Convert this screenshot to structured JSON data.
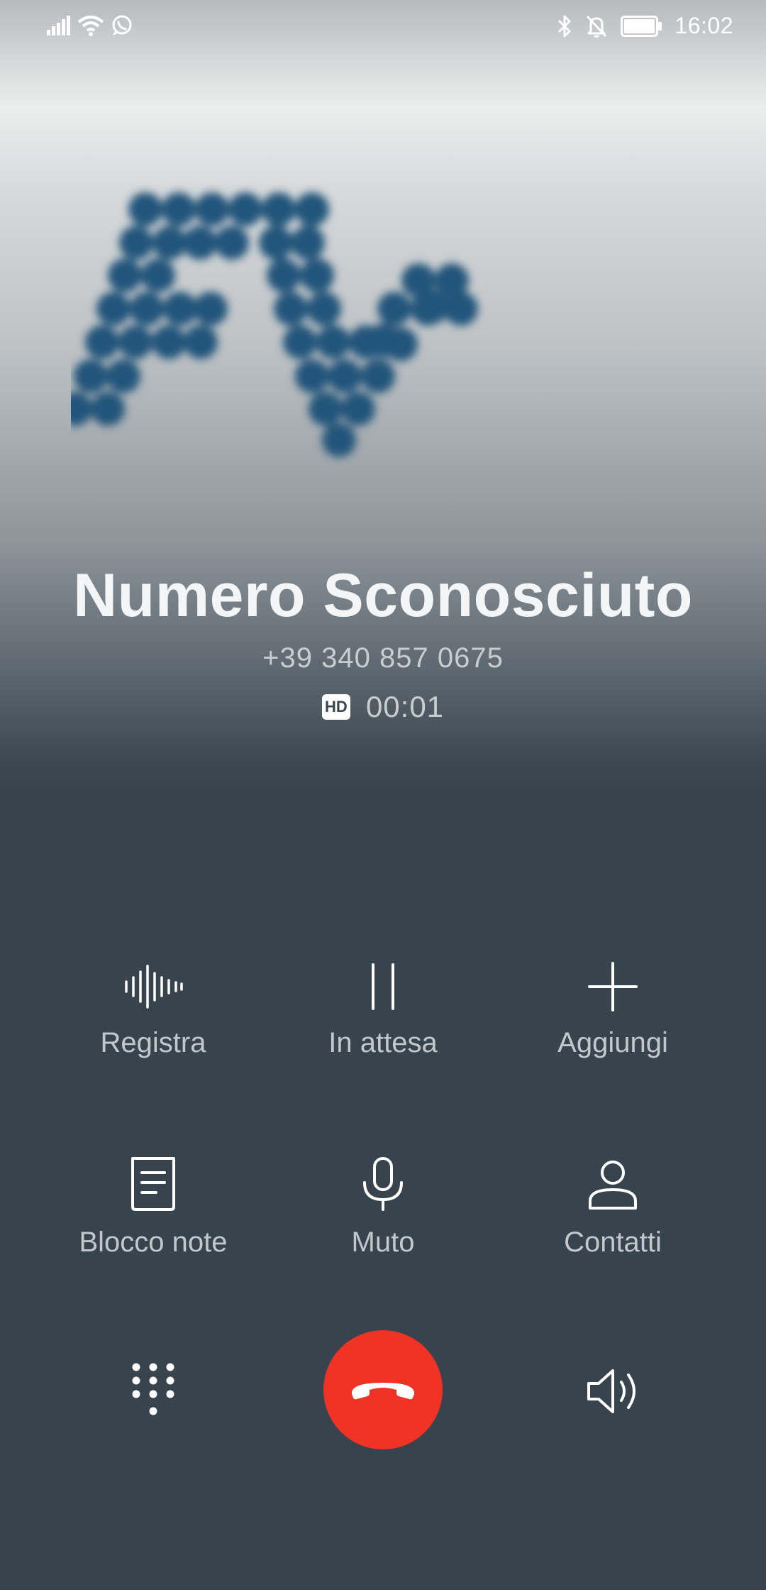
{
  "status_bar": {
    "time": "16:02",
    "left_icons": [
      "signal-icon",
      "wifi-icon",
      "whatsapp-icon"
    ],
    "right_icons": [
      "bluetooth-icon",
      "notifications-off-icon",
      "battery-icon"
    ]
  },
  "caller": {
    "name": "Numero Sconosciuto",
    "number": "+39 340 857 0675",
    "hd_label": "HD",
    "duration": "00:01"
  },
  "actions": [
    {
      "label": "Registra",
      "icon": "record-icon"
    },
    {
      "label": "In attesa",
      "icon": "pause-icon"
    },
    {
      "label": "Aggiungi",
      "icon": "add-icon"
    },
    {
      "label": "Blocco note",
      "icon": "notepad-icon"
    },
    {
      "label": "Muto",
      "icon": "microphone-icon"
    },
    {
      "label": "Contatti",
      "icon": "contact-icon"
    }
  ],
  "bottom_controls": [
    "dialpad-icon",
    "end-call-icon",
    "speaker-icon"
  ],
  "colors": {
    "background": "#37434d",
    "end_call": "#f03324",
    "avatar_dots": "#22547a",
    "text": "#f4f5f6"
  }
}
